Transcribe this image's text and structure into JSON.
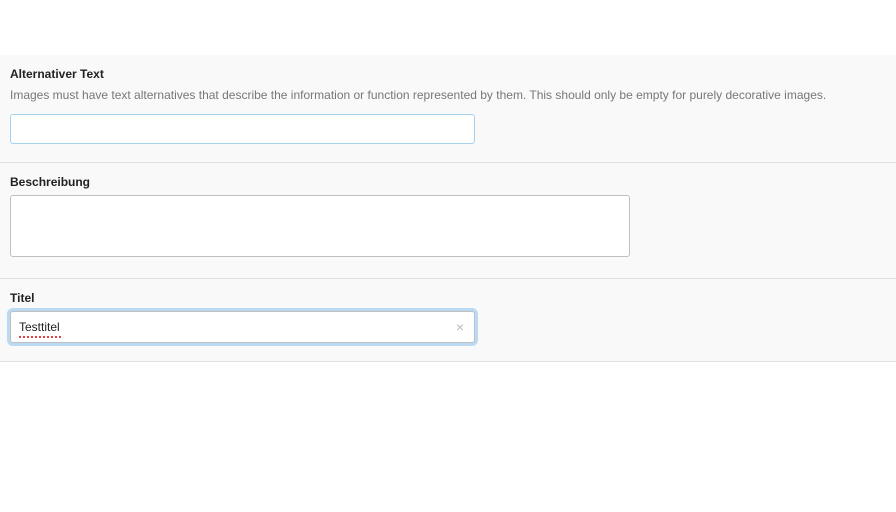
{
  "alt_text": {
    "label": "Alternativer Text",
    "help": "Images must have text alternatives that describe the information or function represented by them. This should only be empty for purely decorative images.",
    "value": ""
  },
  "description": {
    "label": "Beschreibung",
    "value": ""
  },
  "title": {
    "label": "Titel",
    "value": "Testtitel"
  }
}
